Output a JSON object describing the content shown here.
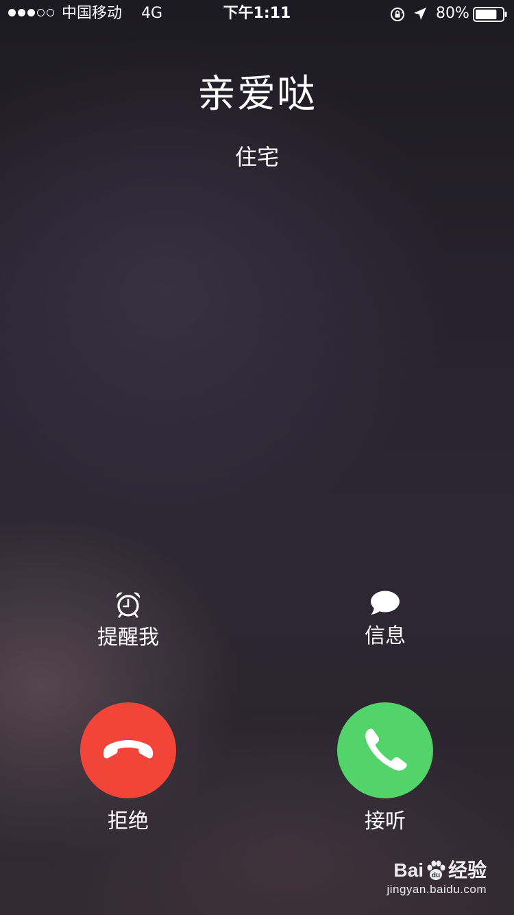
{
  "status_bar": {
    "carrier": "中国移动",
    "network": "4G",
    "time": "下午1:11",
    "battery_percent": "80%",
    "battery_level": 0.8,
    "signal_strength": 3,
    "signal_max": 5,
    "icons": [
      "orientation-lock-icon",
      "location-arrow-icon",
      "battery-icon"
    ]
  },
  "caller": {
    "name": "亲爱哒",
    "label": "住宅"
  },
  "actions": {
    "remind": {
      "label": "提醒我",
      "icon": "alarm-clock-icon"
    },
    "message": {
      "label": "信息",
      "icon": "speech-bubble-icon"
    },
    "decline": {
      "label": "拒绝",
      "icon": "phone-hangup-icon",
      "color": "#f2453a"
    },
    "accept": {
      "label": "接听",
      "icon": "phone-icon",
      "color": "#52d46b"
    }
  },
  "watermark": {
    "brand_left": "Bai",
    "brand_right": "经验",
    "url": "jingyan.baidu.com"
  }
}
